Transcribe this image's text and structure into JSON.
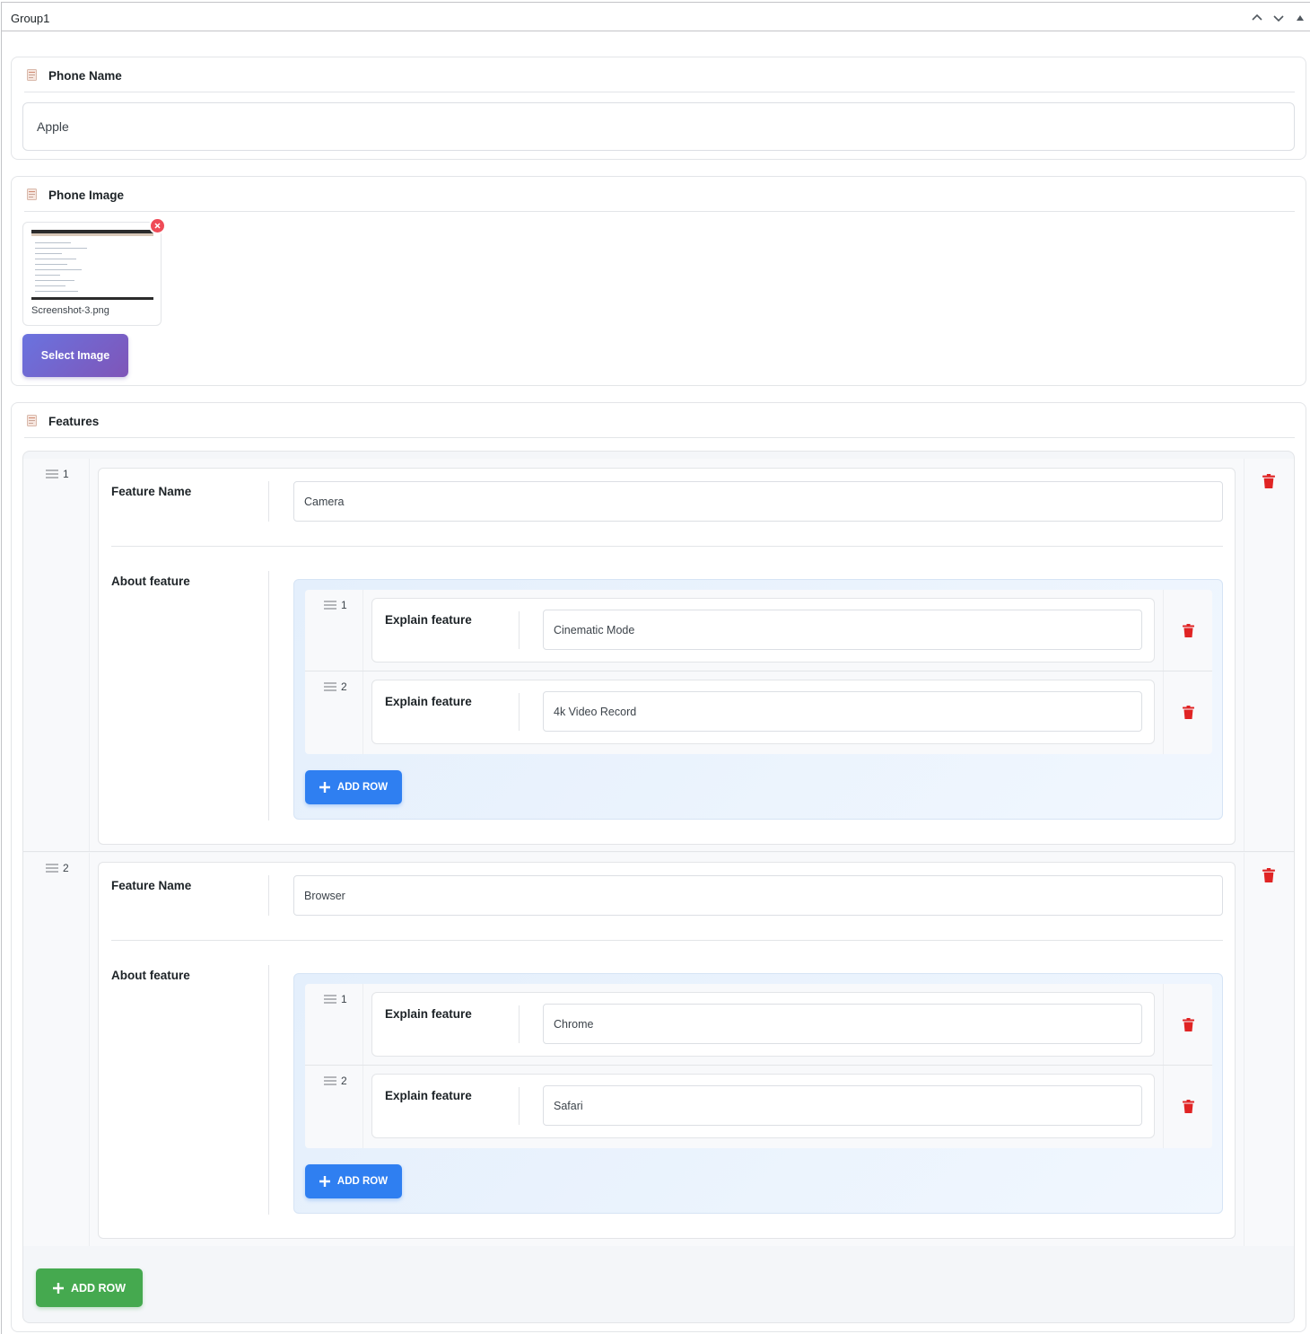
{
  "panel": {
    "title": "Group1"
  },
  "phone_name": {
    "label": "Phone Name",
    "value": "Apple"
  },
  "phone_image": {
    "label": "Phone Image",
    "file_name": "Screenshot-3.png",
    "select_label": "Select Image"
  },
  "features": {
    "label": "Features",
    "rows": [
      {
        "index": "1",
        "name_label": "Feature Name",
        "name_value": "Camera",
        "about_label": "About feature",
        "items": [
          {
            "index": "1",
            "label": "Explain feature",
            "value": "Cinematic Mode"
          },
          {
            "index": "2",
            "label": "Explain feature",
            "value": "4k Video Record"
          }
        ],
        "add_label": "ADD ROW"
      },
      {
        "index": "2",
        "name_label": "Feature Name",
        "name_value": "Browser",
        "about_label": "About feature",
        "items": [
          {
            "index": "1",
            "label": "Explain feature",
            "value": "Chrome"
          },
          {
            "index": "2",
            "label": "Explain feature",
            "value": "Safari"
          }
        ],
        "add_label": "ADD ROW"
      }
    ],
    "add_label": "ADD ROW"
  },
  "colors": {
    "accent_blue": "#2f7ff1",
    "accent_green": "#45a94f",
    "delete_red": "#e02424",
    "purple_gradient_start": "#6a73df",
    "purple_gradient_end": "#7f55b8"
  },
  "icons": {
    "section": "document-icon",
    "handle": "drag-handle-icon",
    "delete": "trash-icon",
    "add": "plus-icon",
    "remove": "close-icon"
  }
}
